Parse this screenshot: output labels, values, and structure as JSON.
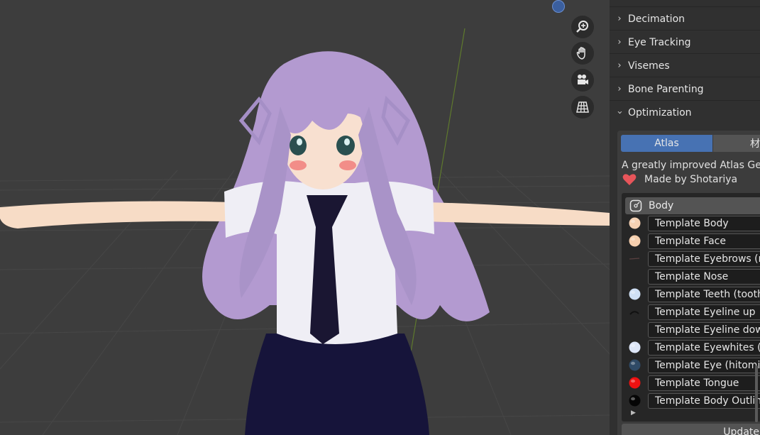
{
  "viewport": {
    "nav_buttons": [
      {
        "name": "zoom-icon"
      },
      {
        "name": "hand-pan-icon"
      },
      {
        "name": "camera-icon"
      },
      {
        "name": "grid-ortho-icon"
      }
    ]
  },
  "panel": {
    "sections": [
      {
        "label": "Decimation",
        "expanded": false
      },
      {
        "label": "Eye Tracking",
        "expanded": false
      },
      {
        "label": "Visemes",
        "expanded": false
      },
      {
        "label": "Bone Parenting",
        "expanded": false
      },
      {
        "label": "Optimization",
        "expanded": true
      }
    ],
    "tabs": {
      "active": "Atlas",
      "other": "材"
    },
    "description_line1": "A greatly improved Atlas Gene",
    "description_line2": "Made by Shotariya",
    "object_row": "Body",
    "materials": [
      {
        "label": "Template Body",
        "icon": "skin-sphere-icon",
        "color": "#f5d1b3"
      },
      {
        "label": "Template Face",
        "icon": "skin-sphere-icon",
        "color": "#f6cfae"
      },
      {
        "label": "Template Eyebrows (m",
        "icon": "eyebrow-icon",
        "color": "#5a4040"
      },
      {
        "label": "Template Nose",
        "icon": "none",
        "color": ""
      },
      {
        "label": "Template Teeth (tooth)",
        "icon": "teeth-sphere-icon",
        "color": "#cfe0f5"
      },
      {
        "label": "Template Eyeline up",
        "icon": "eyeline-icon",
        "color": "#111111"
      },
      {
        "label": "Template Eyeline down",
        "icon": "none",
        "color": ""
      },
      {
        "label": "Template Eyewhites (si",
        "icon": "eyewhite-sphere-icon",
        "color": "#dde6f7"
      },
      {
        "label": "Template Eye (hitomi)",
        "icon": "eye-sphere-icon",
        "color": "#2f4a66"
      },
      {
        "label": "Template Tongue",
        "icon": "tongue-sphere-icon",
        "color": "#ee1111"
      },
      {
        "label": "Template Body Outlin",
        "icon": "outline-sphere-icon",
        "color": "#050505"
      }
    ],
    "update_label": "Update"
  },
  "colors": {
    "accent": "#4772b3",
    "panel_bg": "#303030",
    "viewport_bg": "#3d3d3d"
  }
}
